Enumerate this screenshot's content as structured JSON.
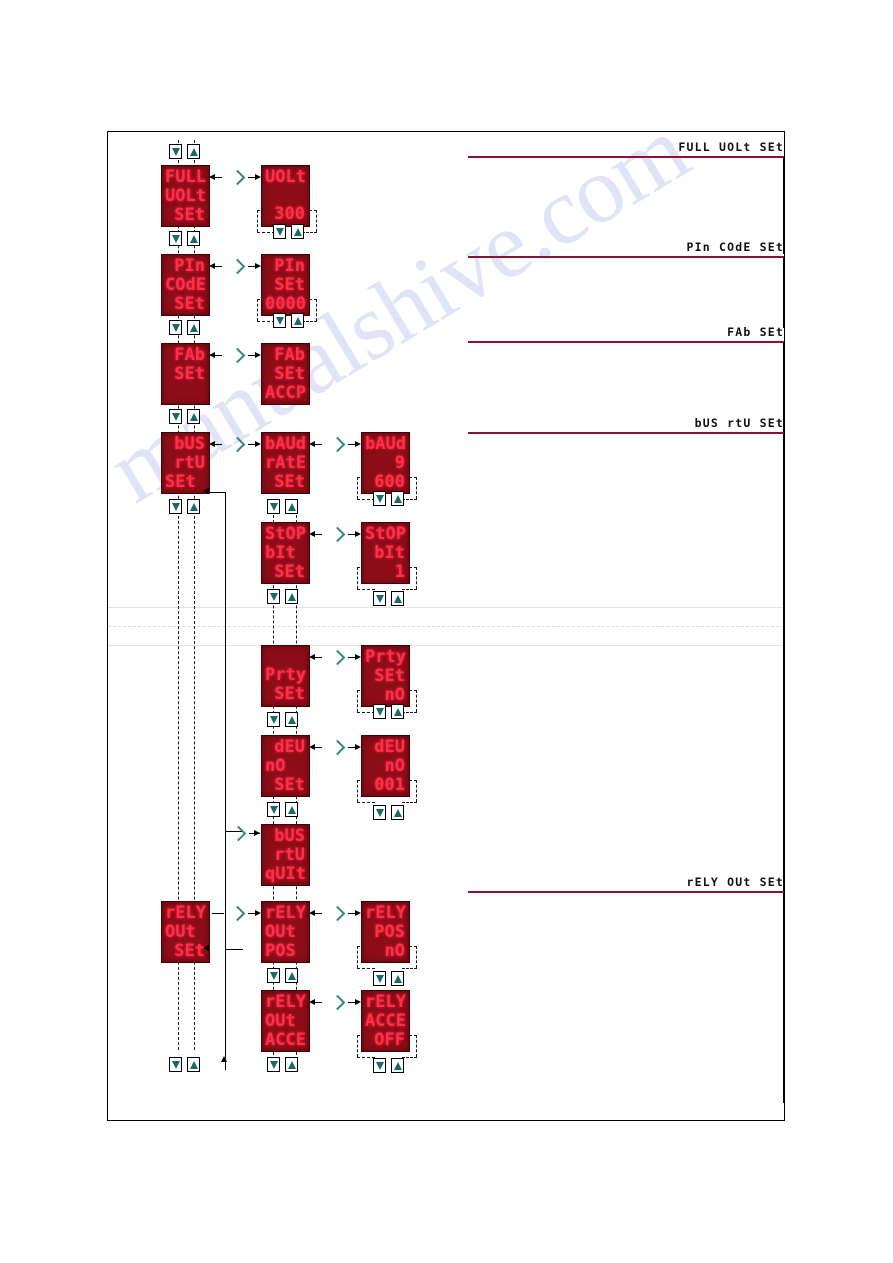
{
  "watermark": "manualshive.com",
  "sections": [
    {
      "label": "FULL  UOLt  SEt"
    },
    {
      "label": "PIn  COdE  SEt"
    },
    {
      "label": "FAb  SEt"
    },
    {
      "label": "bUS  rtU  SEt"
    },
    {
      "label": "rELY  OUt  SEt"
    }
  ],
  "panels": {
    "full_volt_set": {
      "l1": "FULL",
      "l2": "UOLt",
      "l3": "SEt"
    },
    "volt_300": {
      "l1": "UOLt",
      "l2": "",
      "l3": "300"
    },
    "pin_code_set": {
      "l1": "PIn",
      "l2": "COdE",
      "l3": "SEt"
    },
    "pin_set_0000": {
      "l1": "PIn",
      "l2": "SEt",
      "l3": "0000"
    },
    "fab_set": {
      "l1": "FAb",
      "l2": "SEt",
      "l3": ""
    },
    "fab_set_accp": {
      "l1": "FAb",
      "l2": "SEt",
      "l3": "ACCP"
    },
    "bus_rtu_set": {
      "l1": "bUS",
      "l2": "rtU",
      "l3": "SEt"
    },
    "baud_rate_set": {
      "l1": "bAUd",
      "l2": "rAtE",
      "l3": "SEt"
    },
    "baud_9600": {
      "l1": "bAUd",
      "l2": "9",
      "l3": "600"
    },
    "stop_bit_set": {
      "l1": "StOP",
      "l2": "bIt",
      "l3": "SEt"
    },
    "stop_bit_1": {
      "l1": "StOP",
      "l2": "bIt",
      "l3": "1"
    },
    "prty_set": {
      "l1": "Prty",
      "l2": "SEt",
      "l3": ""
    },
    "prty_set_no": {
      "l1": "Prty",
      "l2": "SEt",
      "l3": "nO"
    },
    "deu_no_set": {
      "l1": "dEU",
      "l2": "nO",
      "l3": "SEt"
    },
    "deu_no_001": {
      "l1": "dEU",
      "l2": "nO",
      "l3": "001"
    },
    "bus_rtu_quit": {
      "l1": "bUS",
      "l2": "rtU",
      "l3": "qUIt"
    },
    "rely_out_set": {
      "l1": "rELY",
      "l2": "OUt",
      "l3": "SEt"
    },
    "rely_out_pos": {
      "l1": "rELY",
      "l2": "OUt",
      "l3": "POS"
    },
    "rely_pos_no": {
      "l1": "rELY",
      "l2": "POS",
      "l3": "nO"
    },
    "rely_out_acce": {
      "l1": "rELY",
      "l2": "OUt",
      "l3": "ACCE"
    },
    "rely_acce_off": {
      "l1": "rELY",
      "l2": "ACCE",
      "l3": "OFF"
    }
  },
  "buttons": {
    "down": "▼",
    "up": "▲"
  },
  "colors": {
    "led_background": "#8c0d16",
    "led_text": "#ff2f4a",
    "rule": "#8e1032",
    "arrow_teal": "#176b63",
    "watermark": "#c9cdf0"
  }
}
